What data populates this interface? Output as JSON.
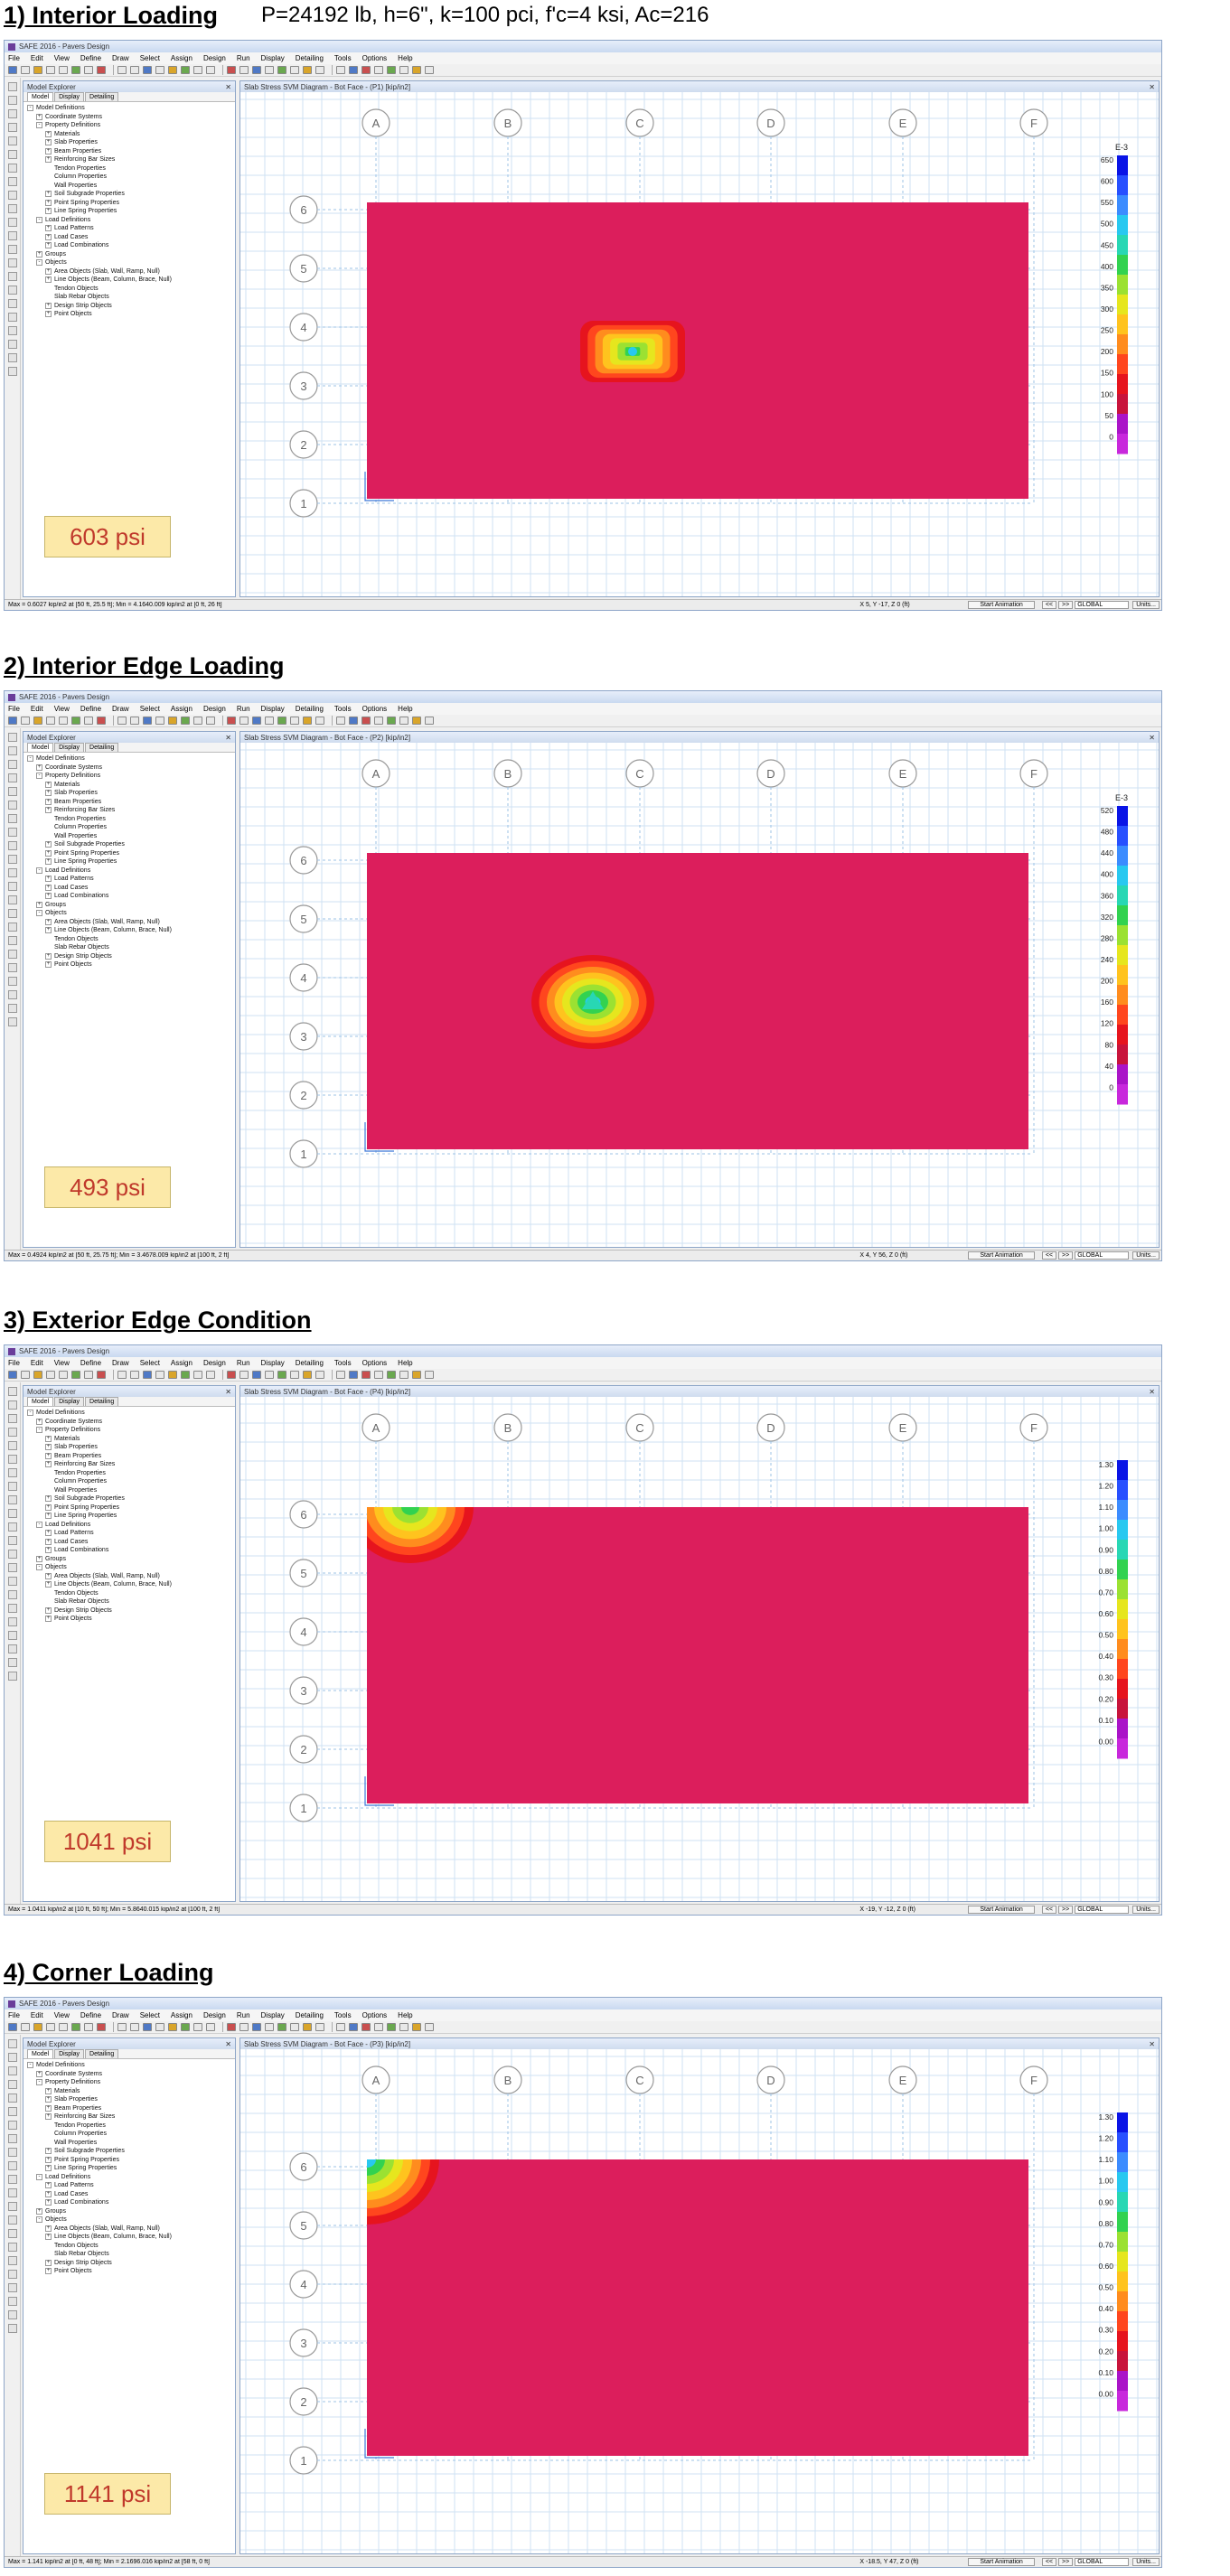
{
  "app": {
    "title": "SAFE 2016 - Pavers Design",
    "menu": [
      "File",
      "Edit",
      "View",
      "Define",
      "Draw",
      "Select",
      "Assign",
      "Design",
      "Run",
      "Display",
      "Detailing",
      "Tools",
      "Options",
      "Help"
    ],
    "explorer_title": "Model Explorer",
    "explorer_tabs": [
      "Model",
      "Display",
      "Detailing"
    ],
    "tree": [
      {
        "d": 0,
        "t": "-",
        "label": "Model Definitions"
      },
      {
        "d": 1,
        "t": "+",
        "label": "Coordinate Systems"
      },
      {
        "d": 1,
        "t": "-",
        "label": "Property Definitions"
      },
      {
        "d": 2,
        "t": "+",
        "label": "Materials"
      },
      {
        "d": 2,
        "t": "+",
        "label": "Slab Properties"
      },
      {
        "d": 2,
        "t": "+",
        "label": "Beam Properties"
      },
      {
        "d": 2,
        "t": "+",
        "label": "Reinforcing Bar Sizes"
      },
      {
        "d": 2,
        "t": "",
        "label": "Tendon Properties"
      },
      {
        "d": 2,
        "t": "",
        "label": "Column Properties"
      },
      {
        "d": 2,
        "t": "",
        "label": "Wall Properties"
      },
      {
        "d": 2,
        "t": "+",
        "label": "Soil Subgrade Properties"
      },
      {
        "d": 2,
        "t": "+",
        "label": "Point Spring Properties"
      },
      {
        "d": 2,
        "t": "+",
        "label": "Line Spring Properties"
      },
      {
        "d": 1,
        "t": "-",
        "label": "Load Definitions"
      },
      {
        "d": 2,
        "t": "+",
        "label": "Load Patterns"
      },
      {
        "d": 2,
        "t": "+",
        "label": "Load Cases"
      },
      {
        "d": 2,
        "t": "+",
        "label": "Load Combinations"
      },
      {
        "d": 1,
        "t": "+",
        "label": "Groups"
      },
      {
        "d": 1,
        "t": "-",
        "label": "Objects"
      },
      {
        "d": 2,
        "t": "+",
        "label": "Area Objects (Slab, Wall, Ramp, Null)"
      },
      {
        "d": 2,
        "t": "+",
        "label": "Line Objects (Beam, Column, Brace, Null)"
      },
      {
        "d": 2,
        "t": "",
        "label": "Tendon Objects"
      },
      {
        "d": 2,
        "t": "",
        "label": "Slab Rebar Objects"
      },
      {
        "d": 2,
        "t": "+",
        "label": "Design Strip Objects"
      },
      {
        "d": 2,
        "t": "+",
        "label": "Point Objects"
      }
    ],
    "grid_cols": [
      "A",
      "B",
      "C",
      "D",
      "E",
      "F"
    ],
    "grid_rows": [
      "6",
      "5",
      "4",
      "3",
      "2",
      "1"
    ],
    "start_animation": "Start Animation",
    "prev": "<<",
    "next": ">>",
    "coord_system": "GLOBAL",
    "units": "Units..."
  },
  "header_params": "P=24192 lb, h=6\", k=100 pci, f'c=4 ksi, Ac=216",
  "colors": {
    "slab": "#dc1e5c",
    "scale": [
      "#0a14e6",
      "#2850ff",
      "#3c8cff",
      "#28c8f0",
      "#28d7b4",
      "#32d250",
      "#9be132",
      "#e6e61e",
      "#ffc31e",
      "#ff8c1e",
      "#ff461e",
      "#e6141e",
      "#c8143c",
      "#aa14c8",
      "#c828dc"
    ]
  },
  "sections": [
    {
      "title": "1) Interior Loading",
      "stress_label": "603 psi",
      "window_title": "Slab Stress SVM Diagram - Bot Face - (P1) [kip/in2]",
      "status_left": "Max = 0.6027 kip/in2 at [50 ft, 25.5 ft];  Min = 4.1640.009 kip/in2 at [0 ft, 26 ft]",
      "status_coords": "X 5, Y -17, Z 0 (ft)",
      "legend_exp": "E-3",
      "legend": [
        "650",
        "600",
        "550",
        "500",
        "450",
        "400",
        "350",
        "300",
        "250",
        "200",
        "150",
        "100",
        "50",
        "0"
      ],
      "hotspot": {
        "kind": "interior",
        "peak": 0.6027
      }
    },
    {
      "title": "2) Interior Edge Loading",
      "stress_label": "493 psi",
      "window_title": "Slab Stress SVM Diagram - Bot Face - (P2) [kip/in2]",
      "status_left": "Max = 0.4924 kip/in2 at [50 ft, 25.75 ft];  Min = 3.4678.009 kip/in2 at [100 ft, 2 ft]",
      "status_coords": "X 4, Y 56, Z 0 (ft)",
      "legend_exp": "E-3",
      "legend": [
        "520",
        "480",
        "440",
        "400",
        "360",
        "320",
        "280",
        "240",
        "200",
        "160",
        "120",
        "80",
        "40",
        "0"
      ],
      "hotspot": {
        "kind": "edge",
        "peak": 0.4924
      }
    },
    {
      "title": "3) Exterior Edge Condition",
      "stress_label": "1041 psi",
      "window_title": "Slab Stress SVM Diagram - Bot Face - (P4) [kip/in2]",
      "status_left": "Max = 1.0411 kip/in2 at [10 ft, 50 ft];  Min = 5.8640.015 kip/in2 at [100 ft, 2 ft]",
      "status_coords": "X -19, Y -12, Z 0 (ft)",
      "legend_exp": "",
      "legend": [
        "1.30",
        "1.20",
        "1.10",
        "1.00",
        "0.90",
        "0.80",
        "0.70",
        "0.60",
        "0.50",
        "0.40",
        "0.30",
        "0.20",
        "0.10",
        "0.00"
      ],
      "hotspot": {
        "kind": "topedge",
        "peak": 1.0411
      }
    },
    {
      "title": "4) Corner Loading",
      "stress_label": "1141 psi",
      "window_title": "Slab Stress SVM Diagram - Bot Face - (P3) [kip/in2]",
      "status_left": "Max = 1.141 kip/in2 at [0 ft, 48 ft];  Min = 2.1696.016 kip/in2 at [58 ft, 0 ft]",
      "status_coords": "X -18.5, Y 47, Z 0 (ft)",
      "legend_exp": "",
      "legend": [
        "1.30",
        "1.20",
        "1.10",
        "1.00",
        "0.90",
        "0.80",
        "0.70",
        "0.60",
        "0.50",
        "0.40",
        "0.30",
        "0.20",
        "0.10",
        "0.00"
      ],
      "hotspot": {
        "kind": "corner",
        "peak": 1.141
      }
    }
  ]
}
